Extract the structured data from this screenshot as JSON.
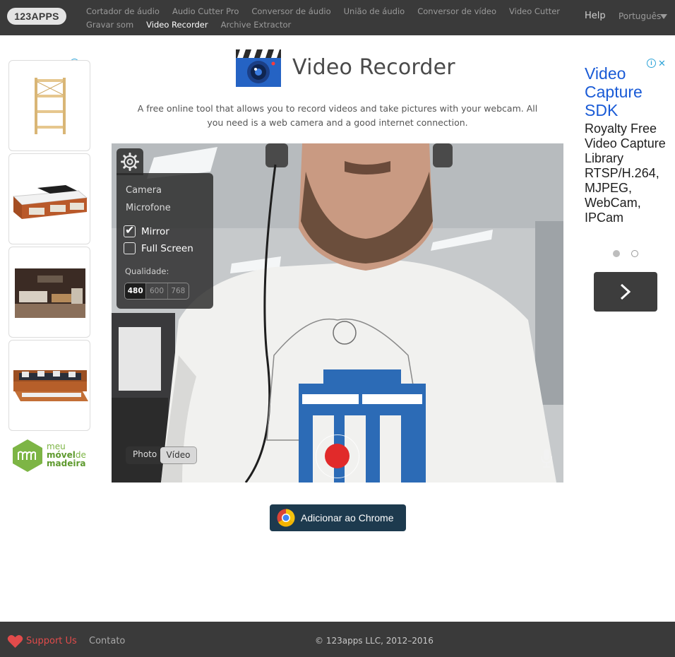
{
  "header": {
    "logo": "123APPS",
    "nav_row1": [
      "Cortador de áudio",
      "Audio Cutter Pro",
      "Conversor de áudio",
      "União de áudio",
      "Conversor de vídeo",
      "Video Cutter"
    ],
    "nav_row2": [
      "Gravar som",
      "Video Recorder",
      "Archive Extractor"
    ],
    "active_item": "Video Recorder",
    "help": "Help",
    "language": "Português"
  },
  "main": {
    "title": "Video Recorder",
    "description": "A free online tool that allows you to record videos and take pictures with your webcam. All you need is a web camera and a good internet connection."
  },
  "recorder": {
    "settings": {
      "camera_label": "Camera",
      "microphone_label": "Microfone",
      "mirror_label": "Mirror",
      "mirror_checked": true,
      "fullscreen_label": "Full Screen",
      "fullscreen_checked": false,
      "quality_label": "Qualidade:",
      "quality_options": [
        "480",
        "600",
        "768"
      ],
      "quality_selected": "480"
    },
    "mode": {
      "photo_label": "Photo",
      "video_label": "Vídeo",
      "selected": "Vídeo"
    },
    "record_color": "#e12a2a"
  },
  "chrome_button": {
    "label": "Adicionar ao Chrome"
  },
  "left_ad": {
    "brand_line1": "meu",
    "brand_line2": "móvel",
    "brand_line2b": "de",
    "brand_line3": "madeira"
  },
  "right_ad": {
    "title": "Video Capture SDK",
    "body": "Royalty Free Video Capture Library RTSP/H.264, MJPEG, WebCam, IPCam"
  },
  "footer": {
    "support": "Support Us",
    "contact": "Contato",
    "copyright": "© 123apps LLC, 2012–2016"
  },
  "colors": {
    "topbar": "#3a3a3a",
    "accent_link": "#1a5bd6",
    "support_red": "#e14b4b",
    "chrome_button": "#1d3a4e"
  }
}
